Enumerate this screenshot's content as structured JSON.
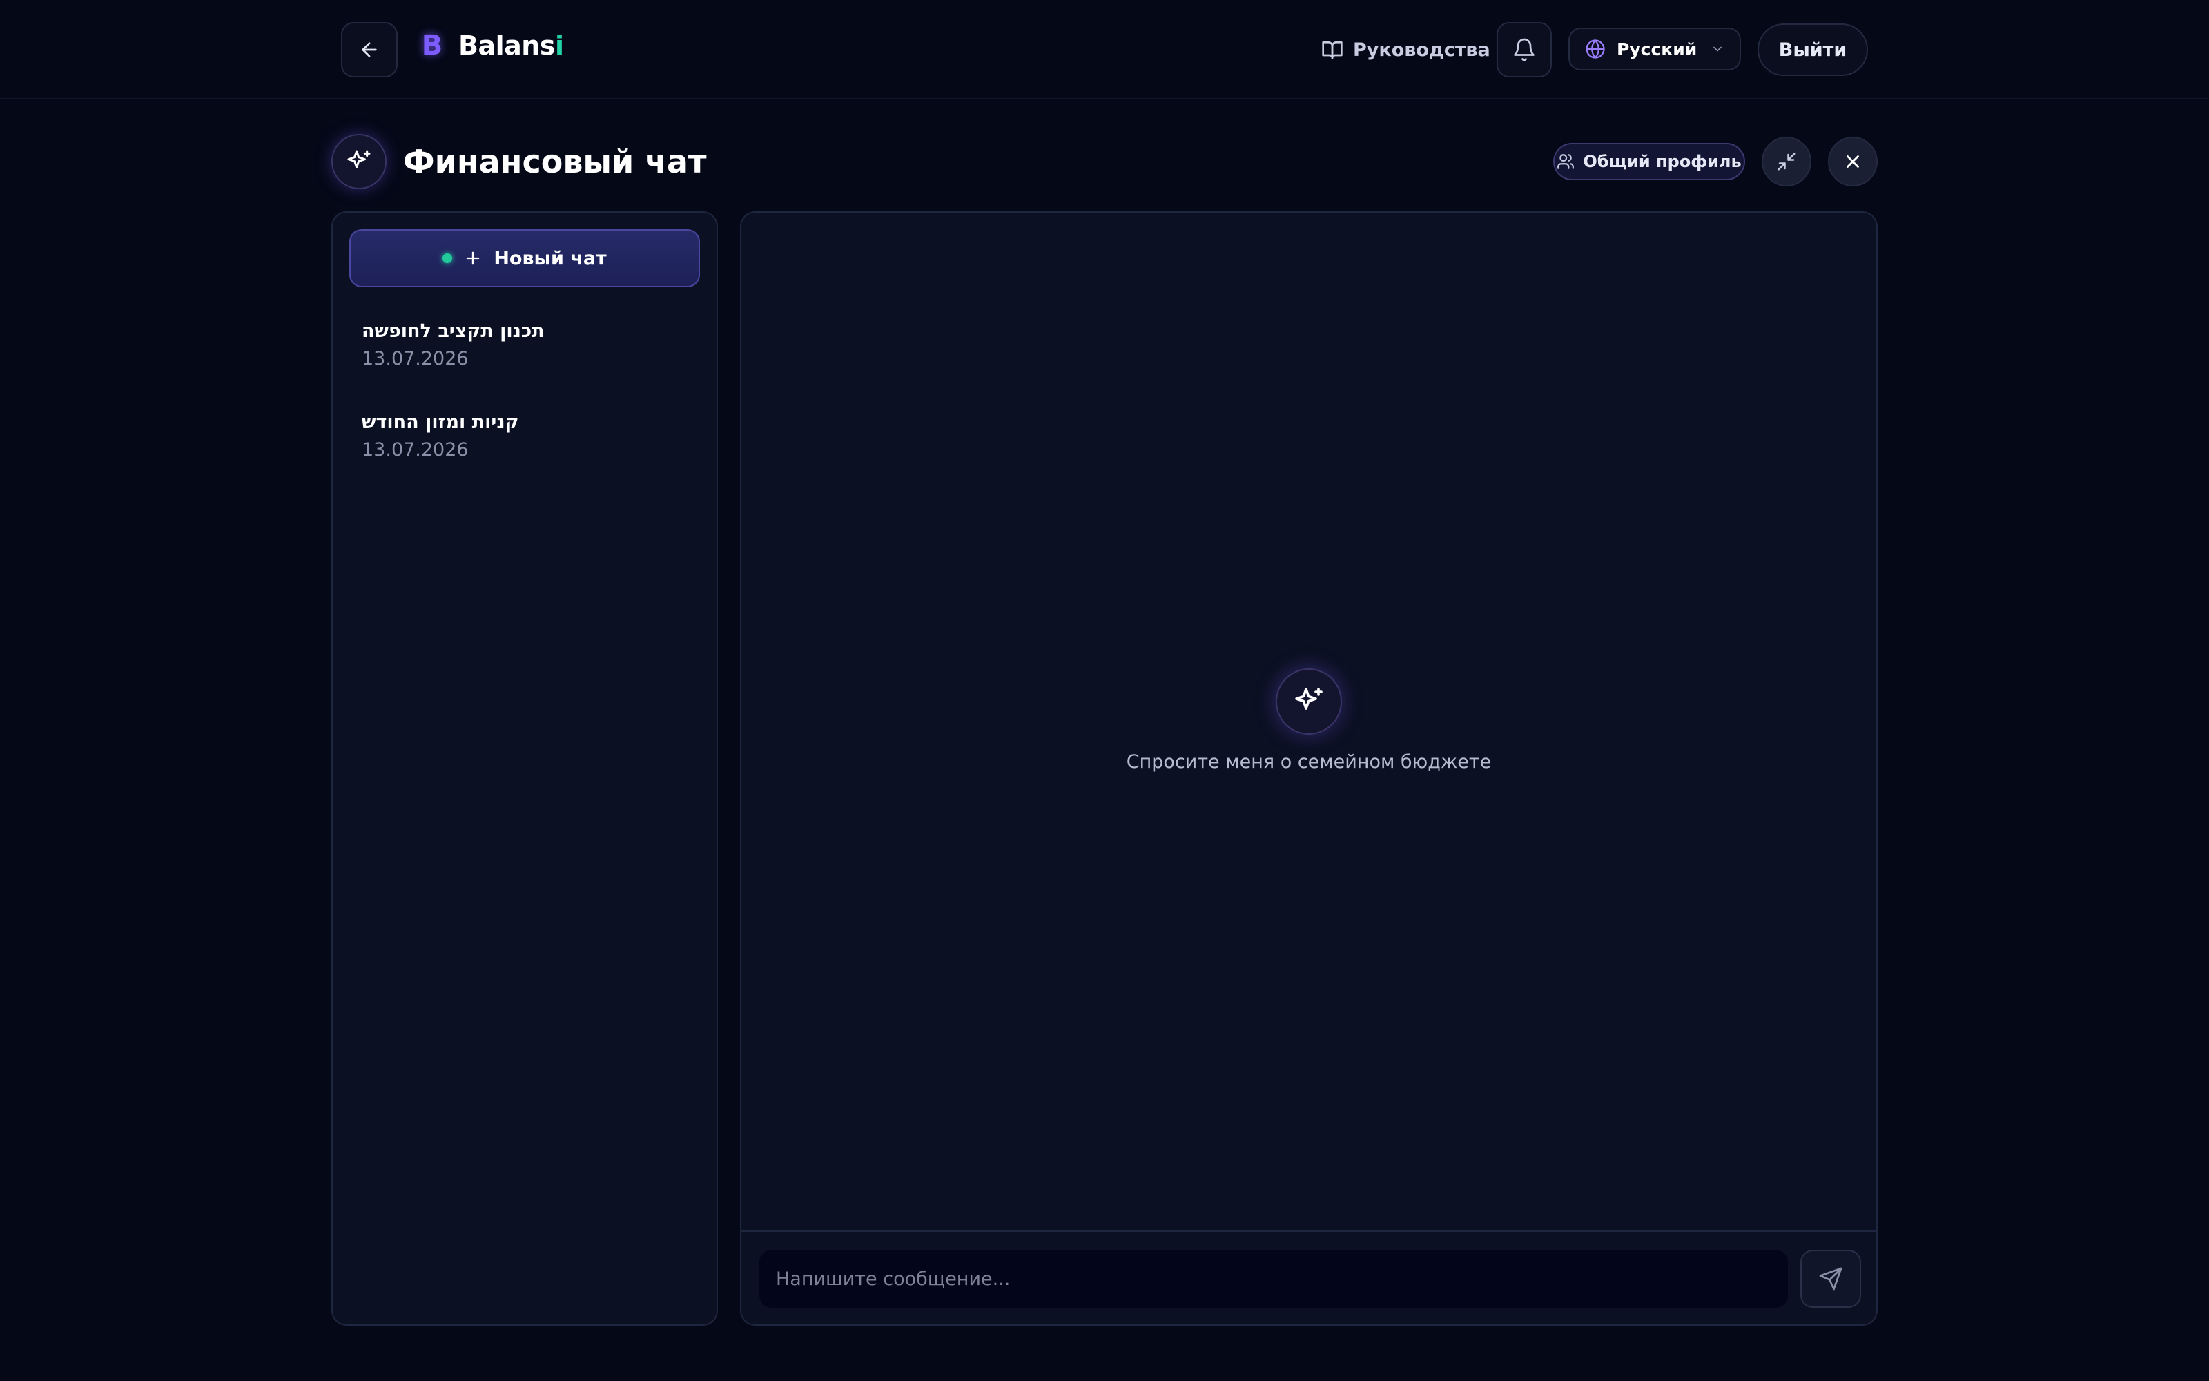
{
  "header": {
    "back_icon": "arrow-left-icon",
    "logo": {
      "text_main": "Balans",
      "text_accent": "i",
      "mark": "B",
      "accent_color": "#22d3a5",
      "mark_color": "#7c5cff"
    },
    "guides_label": "Руководства",
    "guides_icon": "book-icon",
    "bell_icon": "bell-icon",
    "language": {
      "selected": "Русский",
      "icon": "globe-icon"
    },
    "logout_label": "Выйти"
  },
  "page": {
    "title": "Финансовый чат",
    "title_icon": "sparkles-icon",
    "profile_badge": "Общий профиль",
    "profile_icon": "users-icon",
    "minimize_icon": "minimize-icon",
    "close_icon": "close-icon"
  },
  "sidebar": {
    "new_chat_label": "Новый чат",
    "chats": [
      {
        "title": "תכנון תקציב לחופשה",
        "date": "13.07.2026"
      },
      {
        "title": "קניות ומזון החודש",
        "date": "13.07.2026"
      }
    ]
  },
  "chat": {
    "empty_text": "Спросите меня о семейном бюджете",
    "input_placeholder": "Напишите сообщение...",
    "input_value": "",
    "send_icon": "send-icon"
  },
  "colors": {
    "background": "#050817",
    "panel": "#0b1022",
    "accent_purple": "#7c5cff",
    "accent_green": "#22c99a"
  }
}
